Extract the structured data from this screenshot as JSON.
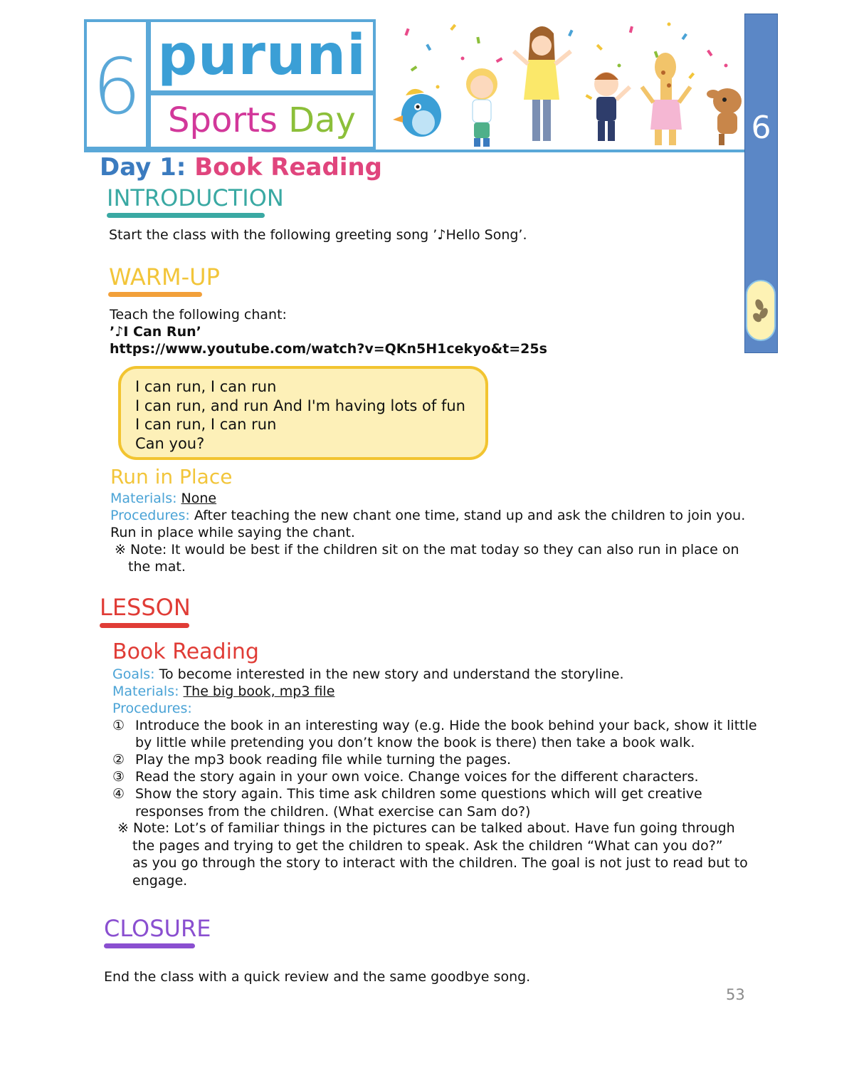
{
  "header": {
    "unit_number": "6",
    "brand": "puruni",
    "subtitle_word1": "Sports",
    "subtitle_word2": "Day",
    "side_tab_number": "6"
  },
  "page_title": {
    "day": "Day 1:",
    "name": "Book Reading"
  },
  "introduction": {
    "heading": "INTRODUCTION",
    "text": "Start the class with the following greeting song ’♪Hello Song’."
  },
  "warmup": {
    "heading": "WARM-UP",
    "intro": "Teach the following chant:",
    "song_title": "’♪I Can Run’",
    "url": "https://www.youtube.com/watch?v=QKn5H1cekyo&t=25s",
    "chant_lines": [
      "I can run, I can run",
      "I can run, and run And I'm having lots of fun",
      "I can run, I can run",
      "Can you?"
    ]
  },
  "activity": {
    "title": "Run in Place",
    "materials_label": "Materials:",
    "materials": "None",
    "procedures_label": "Procedures:",
    "procedures": "After teaching the new chant one time, stand up and ask the children to join you.",
    "procedures_cont": "Run in place while saying the chant.",
    "note_line1": "※ Note: It would be best if the children sit on the mat today so they can also run in place on",
    "note_line2": "the mat."
  },
  "lesson": {
    "heading": "LESSON",
    "title": "Book Reading",
    "goals_label": "Goals:",
    "goals": "To become interested in the new story and understand the storyline.",
    "materials_label": "Materials:",
    "materials": "The big book, mp3 file",
    "procedures_label": "Procedures:",
    "steps": [
      {
        "num": "①",
        "l1": "Introduce the book in an interesting way (e.g. Hide the book behind your back, show it little",
        "l2": "by little while pretending you don’t know the book is there) then take a book walk."
      },
      {
        "num": "②",
        "l1": "Play the mp3 book reading file while turning the pages.",
        "l2": ""
      },
      {
        "num": "③",
        "l1": "Read the story again in your own voice.  Change voices for the different characters.",
        "l2": ""
      },
      {
        "num": "④",
        "l1": "Show the story again. This time ask children some questions which will get creative",
        "l2": "responses from the children. (What exercise can Sam do?)"
      }
    ],
    "note_lines": [
      "※ Note: Lot’s of familiar things in the pictures can be talked about. Have fun going through",
      "the pages and trying to get the children to speak. Ask the children “What can you do?”",
      "as you go through the story to interact with the children. The goal is not just to read but to",
      "engage."
    ]
  },
  "closure": {
    "heading": "CLOSURE",
    "text": "End the class with a quick review and the same goodbye song."
  },
  "page_number": "53",
  "colors": {
    "frame_blue": "#5aa8d8",
    "title_blue": "#3b7bbf",
    "title_pink": "#e0457d",
    "intro_teal": "#3aa9a3",
    "warmup_yellow": "#f2c53a",
    "lesson_red": "#e03c36",
    "closure_purple": "#8a4fd0",
    "label_blue": "#4aa3d6",
    "tab_blue": "#5b87c6",
    "chant_fill": "#fdf0b8",
    "chant_border": "#f2c430"
  }
}
